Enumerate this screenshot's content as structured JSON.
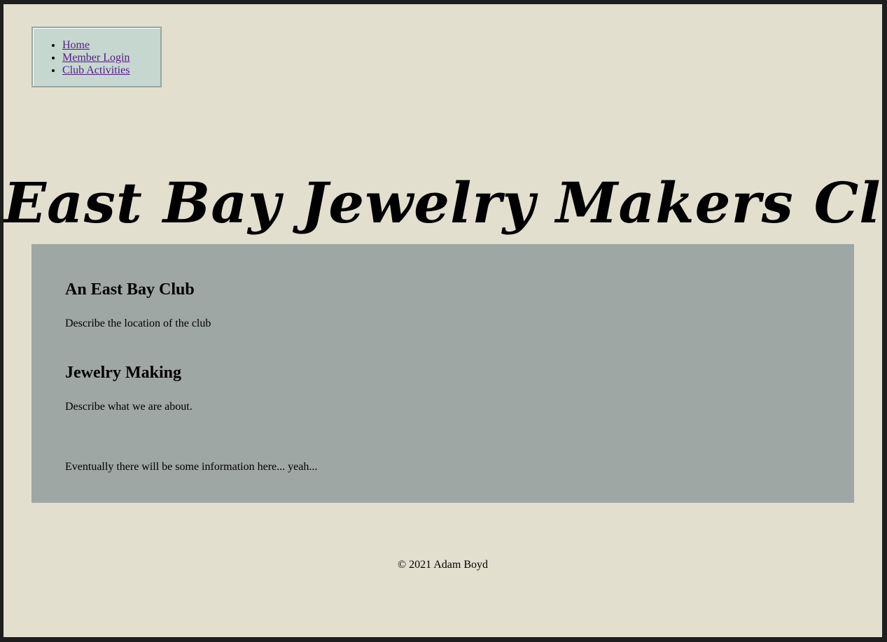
{
  "nav": {
    "items": [
      {
        "label": "Home"
      },
      {
        "label": "Member Login"
      },
      {
        "label": "Club Activities"
      }
    ]
  },
  "header": {
    "title": "East Bay Jewelry Makers Club"
  },
  "main": {
    "sections": [
      {
        "heading": "An East Bay Club",
        "text": "Describe the location of the club"
      },
      {
        "heading": "Jewelry Making",
        "text": "Describe what we are about."
      }
    ],
    "note": "Eventually there will be some information here... yeah..."
  },
  "footer": {
    "text": "© 2021 Adam Boyd"
  },
  "colors": {
    "page_background": "#e2dfcf",
    "nav_background": "#c6d7cf",
    "panel_background": "#9ea7a3",
    "link_color": "#551a8b"
  }
}
